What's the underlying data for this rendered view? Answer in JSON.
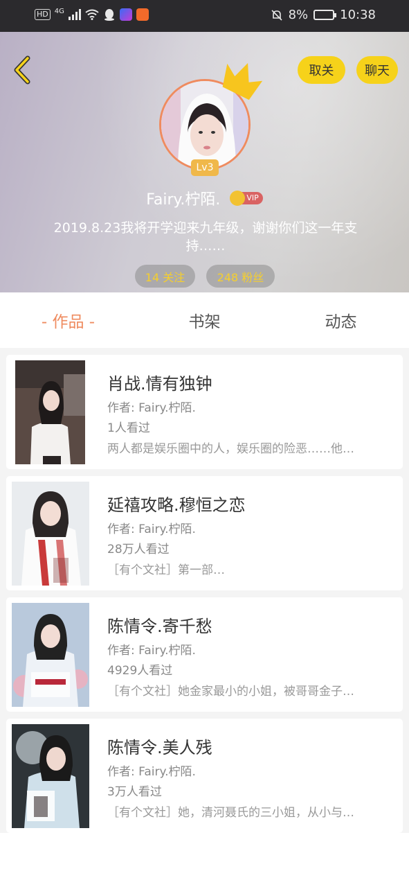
{
  "status_bar": {
    "hd": "HD",
    "network": "4G",
    "battery_percent": "8%",
    "time": "10:38"
  },
  "header": {
    "follow_toggle_label": "取关",
    "chat_label": "聊天",
    "level": "Lv3",
    "nickname": "Fairy.柠陌.",
    "vip_label": "VIP",
    "bio": "2019.8.23我将开学迎来九年级，谢谢你们这一年支持……",
    "following": "14 关注",
    "fans": "248 粉丝"
  },
  "tabs": [
    {
      "label": "- 作品 -",
      "active": true
    },
    {
      "label": "书架",
      "active": false
    },
    {
      "label": "动态",
      "active": false
    }
  ],
  "works": [
    {
      "title": "肖战.情有独钟",
      "author": "作者: Fairy.柠陌.",
      "views": "1人看过",
      "desc": "两人都是娱乐圈中的人，娱乐圈的险恶……他…"
    },
    {
      "title": "延禧攻略.穆恒之恋",
      "author": "作者: Fairy.柠陌.",
      "views": "28万人看过",
      "desc": "［有个文社］第一部…"
    },
    {
      "title": "陈情令.寄千愁",
      "author": "作者: Fairy.柠陌.",
      "views": "4929人看过",
      "desc": "［有个文社］她金家最小的小姐，被哥哥金子…"
    },
    {
      "title": "陈情令.美人残",
      "author": "作者: Fairy.柠陌.",
      "views": "3万人看过",
      "desc": "［有个文社］她，清河聂氏的三小姐，从小与…"
    }
  ],
  "colors": {
    "accent": "#ef8b5f",
    "button_yellow": "#f6d21a",
    "count_yellow": "#f6cf2c"
  }
}
